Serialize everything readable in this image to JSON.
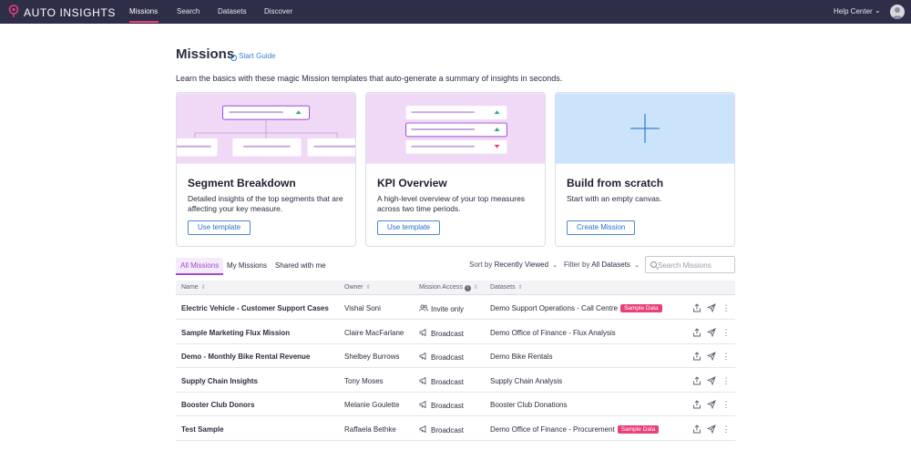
{
  "app": {
    "brand": "AUTO INSIGHTS",
    "nav": [
      "Missions",
      "Search",
      "Datasets",
      "Discover"
    ],
    "help": "Help Center",
    "accent": "#e8407a",
    "nav_bg": "#2e2e48"
  },
  "header": {
    "title": "Missions",
    "guide": "Start Guide",
    "intro": "Learn the basics with these magic Mission templates that auto-generate a summary of insights in seconds."
  },
  "cards": [
    {
      "title": "Segment Breakdown",
      "desc": "Detailed insights of the top segments that are affecting your key measure.",
      "button": "Use template"
    },
    {
      "title": "KPI Overview",
      "desc": "A high-level overview of your top measures across two time periods.",
      "button": "Use template"
    },
    {
      "title": "Build from scratch",
      "desc": "Start with an empty canvas.",
      "button": "Create Mission"
    }
  ],
  "tabs": [
    "All Missions",
    "My Missions",
    "Shared with me"
  ],
  "controls": {
    "sort_label": "Sort by",
    "sort_value": "Recently Viewed",
    "filter_label": "Filter by",
    "filter_value": "All Datasets",
    "search_placeholder": "Search Missions"
  },
  "table": {
    "headers": [
      "Name",
      "Owner",
      "Mission Access",
      "Datasets"
    ],
    "rows": [
      {
        "name": "Electric Vehicle - Customer Support Cases",
        "owner": "Vishal Soni",
        "access": "Invite only",
        "access_icon": "people-icon",
        "dataset": "Demo Support Operations - Call Centre",
        "badge": "Sample Data"
      },
      {
        "name": "Sample Marketing Flux Mission",
        "owner": "Claire MacFarlane",
        "access": "Broadcast",
        "access_icon": "megaphone-icon",
        "dataset": "Demo Office of Finance - Flux Analysis",
        "badge": ""
      },
      {
        "name": "Demo - Monthly Bike Rental Revenue",
        "owner": "Shelbey Burrows",
        "access": "Broadcast",
        "access_icon": "megaphone-icon",
        "dataset": "Demo Bike Rentals",
        "badge": ""
      },
      {
        "name": "Supply Chain Insights",
        "owner": "Tony Moses",
        "access": "Broadcast",
        "access_icon": "megaphone-icon",
        "dataset": "Supply Chain Analysis",
        "badge": ""
      },
      {
        "name": "Booster Club Donors",
        "owner": "Melanie Goulette",
        "access": "Broadcast",
        "access_icon": "megaphone-icon",
        "dataset": "Booster Club Donations",
        "badge": ""
      },
      {
        "name": "Test Sample",
        "owner": "Raffaela Bethke",
        "access": "Broadcast",
        "access_icon": "megaphone-icon",
        "dataset": "Demo Office of Finance - Procurement",
        "badge": "Sample Data"
      }
    ]
  }
}
